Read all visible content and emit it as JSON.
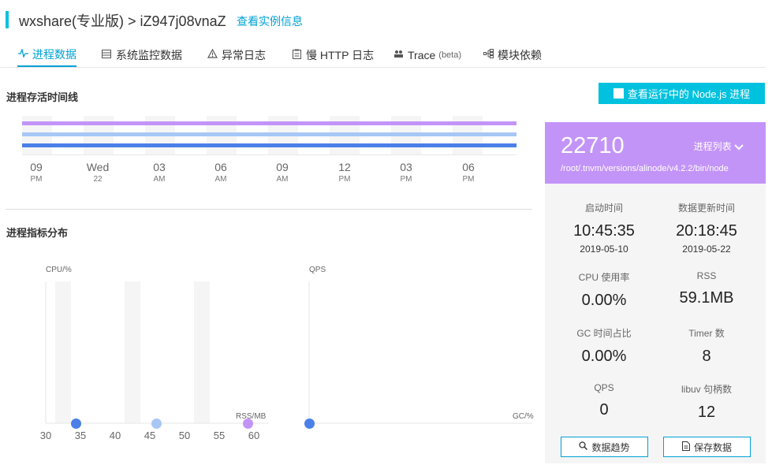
{
  "header": {
    "title": "wxshare(专业版)  >  iZ947j08vnaZ",
    "link": "查看实例信息"
  },
  "tabs": [
    {
      "label": "进程数据",
      "icon": "pulse-icon"
    },
    {
      "label": "系统监控数据",
      "icon": "server-icon"
    },
    {
      "label": "异常日志",
      "icon": "warning-icon"
    },
    {
      "label": "慢 HTTP 日志",
      "icon": "clipboard-icon"
    },
    {
      "label": "Trace",
      "sub": "(beta)",
      "icon": "users-icon"
    },
    {
      "label": "模块依赖",
      "icon": "hierarchy-icon"
    }
  ],
  "timeline": {
    "title": "进程存活时间线",
    "action_button": "查看运行中的 Node.js 进程",
    "ticks": [
      {
        "a": "09",
        "b": "PM"
      },
      {
        "a": "Wed",
        "b": "22"
      },
      {
        "a": "03",
        "b": "AM"
      },
      {
        "a": "06",
        "b": "AM"
      },
      {
        "a": "09",
        "b": "AM"
      },
      {
        "a": "12",
        "b": "PM"
      },
      {
        "a": "03",
        "b": "PM"
      },
      {
        "a": "06",
        "b": "PM"
      }
    ],
    "colors": [
      "#c394f8",
      "#a7c7f5",
      "#4a80e8"
    ]
  },
  "distribution": {
    "title": "进程指标分布",
    "left_ylabel": "CPU/%",
    "left_xlabel": "RSS/MB",
    "right_ylabel": "QPS",
    "right_xlabel": "GC/%",
    "xticks": [
      "30",
      "35",
      "40",
      "45",
      "50",
      "55",
      "60"
    ]
  },
  "chart_data": [
    {
      "type": "scatter",
      "xlabel": "RSS/MB",
      "ylabel": "CPU/%",
      "xlim": [
        30,
        60
      ],
      "x_ticks": [
        30,
        35,
        40,
        45,
        50,
        55,
        60
      ],
      "points": [
        {
          "x": 34.3,
          "y": 0,
          "color": "#4a80e8"
        },
        {
          "x": 45.9,
          "y": 0,
          "color": "#a7c7f5"
        },
        {
          "x": 59.1,
          "y": 0,
          "color": "#c394f8"
        }
      ]
    },
    {
      "type": "scatter",
      "xlabel": "GC/%",
      "ylabel": "QPS",
      "points": [
        {
          "x": 0,
          "y": 0,
          "color": "#4a80e8"
        }
      ]
    }
  ],
  "process": {
    "pid": "22710",
    "list_label": "进程列表",
    "path": "/root/.tnvm/versions/alinode/v4.2.2/bin/node",
    "stats": [
      {
        "label": "启动时间",
        "value": "10:45:35",
        "sub": "2019-05-10"
      },
      {
        "label": "数据更新时间",
        "value": "20:18:45",
        "sub": "2019-05-22"
      },
      {
        "label": "CPU 使用率",
        "value": "0.00%"
      },
      {
        "label": "RSS",
        "value": "59.1MB"
      },
      {
        "label": "GC 时间占比",
        "value": "0.00%"
      },
      {
        "label": "Timer 数",
        "value": "8"
      },
      {
        "label": "QPS",
        "value": "0"
      },
      {
        "label": "libuv 句柄数",
        "value": "12"
      }
    ],
    "trend_button": "数据趋势",
    "save_button": "保存数据"
  }
}
